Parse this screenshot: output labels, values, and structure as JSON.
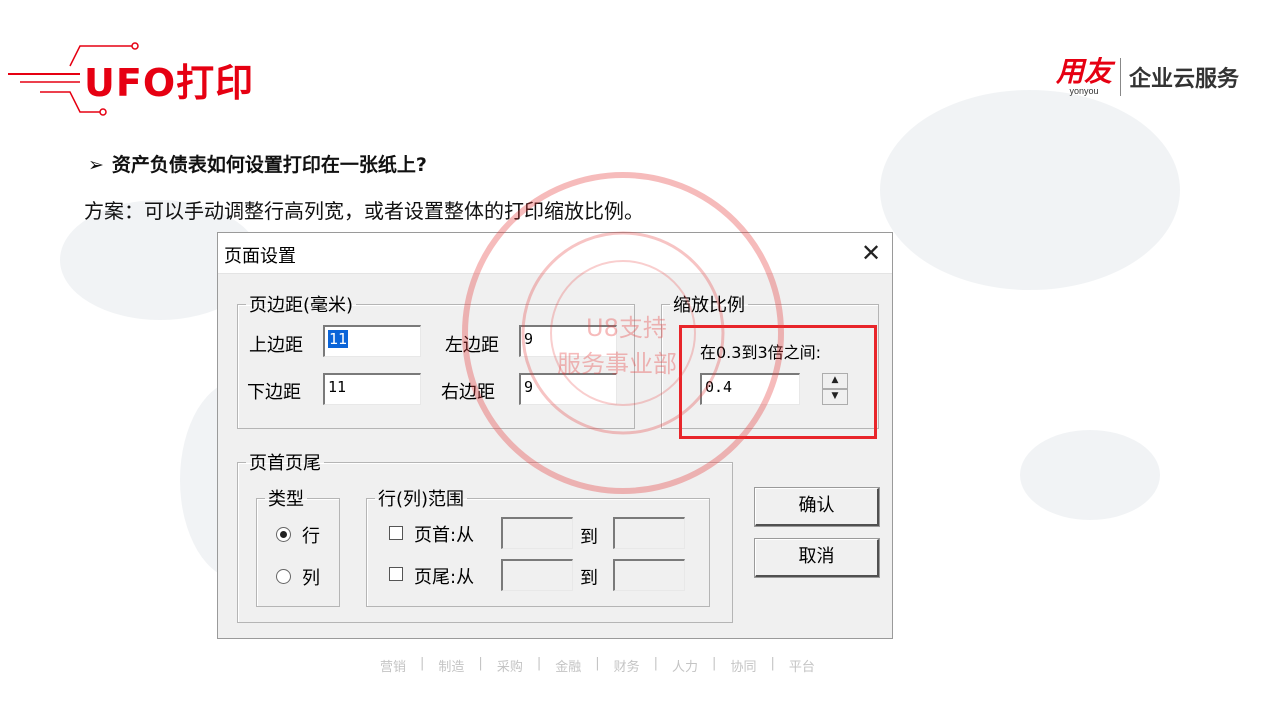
{
  "slide": {
    "title": "UFO打印",
    "question_bullet": "➢",
    "question": "资产负债表如何设置打印在一张纸上?",
    "answer": "方案：可以手动调整行高列宽，或者设置整体的打印缩放比例。"
  },
  "brand": {
    "logo_main": "用友",
    "logo_sub": "yonyou",
    "tagline": "企业云服务",
    "color": "#e60012"
  },
  "dialog": {
    "title": "页面设置",
    "close_glyph": "✕",
    "margins": {
      "legend": "页边距(毫米)",
      "top_label": "上边距",
      "top_value": "11",
      "left_label": "左边距",
      "left_value": "9",
      "bottom_label": "下边距",
      "bottom_value": "11",
      "right_label": "右边距",
      "right_value": "9"
    },
    "scale": {
      "legend": "缩放比例",
      "hint": "在0.3到3倍之间:",
      "value": "0.4"
    },
    "header_footer": {
      "legend": "页首页尾",
      "type_legend": "类型",
      "type_row": "行",
      "type_col": "列",
      "range_legend": "行(列)范围",
      "header_label": "页首:从",
      "footer_label": "页尾:从",
      "to_label": "到"
    },
    "ok_label": "确认",
    "cancel_label": "取消"
  },
  "stamp": {
    "line1": "U8支持",
    "line2": "服务事业部",
    "color": "#e63c3c"
  },
  "footer": {
    "items": [
      "营销",
      "制造",
      "采购",
      "金融",
      "财务",
      "人力",
      "协同",
      "平台"
    ]
  }
}
